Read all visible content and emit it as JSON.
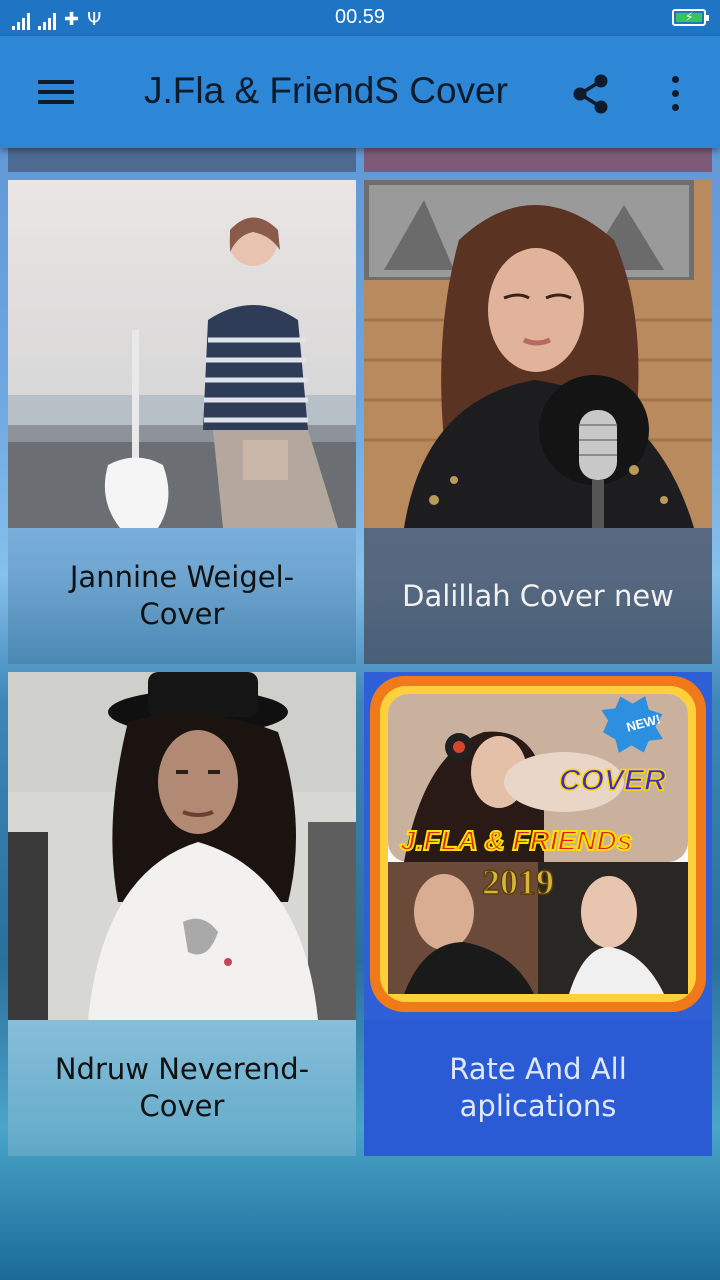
{
  "status_bar": {
    "time": "00.59"
  },
  "app_bar": {
    "title": "J.Fla & FriendS Cover"
  },
  "cards": [
    {
      "label": "Jannine Weigel-Cover"
    },
    {
      "label": "Dalillah Cover new"
    },
    {
      "label": "Ndruw Neverend-Cover"
    },
    {
      "label": "Rate And All aplications"
    }
  ],
  "promo_image": {
    "badge": "NEW!",
    "cover_text": "COVER",
    "title_text": "J.FLA & FRIENDs",
    "year_text": "2019"
  },
  "colors": {
    "status_bar": "#1f74c4",
    "app_bar": "#2d86d6",
    "rate_card": "#2f5fd6"
  },
  "icons": {
    "menu": "hamburger-icon",
    "share": "share-icon",
    "more": "more-vert-icon"
  }
}
